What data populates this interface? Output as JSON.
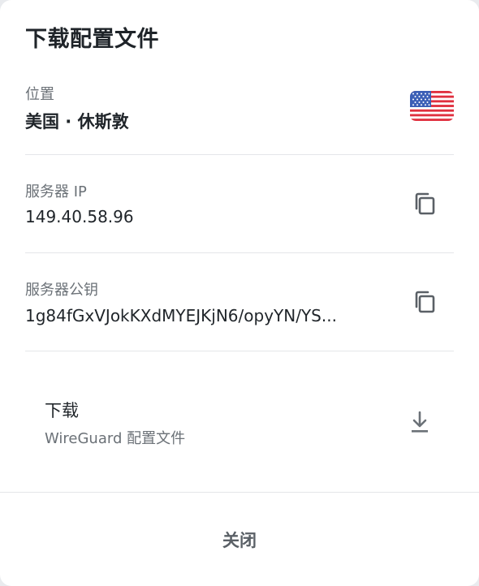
{
  "dialog": {
    "title": "下载配置文件"
  },
  "location": {
    "label": "位置",
    "value": "美国 · 休斯敦",
    "flag_icon": "us-flag-icon"
  },
  "server_ip": {
    "label": "服务器 IP",
    "value": "149.40.58.96",
    "copy_icon": "copy-icon"
  },
  "public_key": {
    "label": "服务器公钥",
    "value": "1g84fGxVJokKXdMYEJKjN6/opyYN/YS...",
    "copy_icon": "copy-icon"
  },
  "download": {
    "title": "下载",
    "subtitle": "WireGuard 配置文件",
    "icon": "download-icon"
  },
  "footer": {
    "close_label": "关闭"
  },
  "colors": {
    "background": "#ffffff",
    "primary_text": "#1f2429",
    "secondary_text": "#6b7177",
    "icon": "#5a6066",
    "divider": "#e4e6e9"
  }
}
